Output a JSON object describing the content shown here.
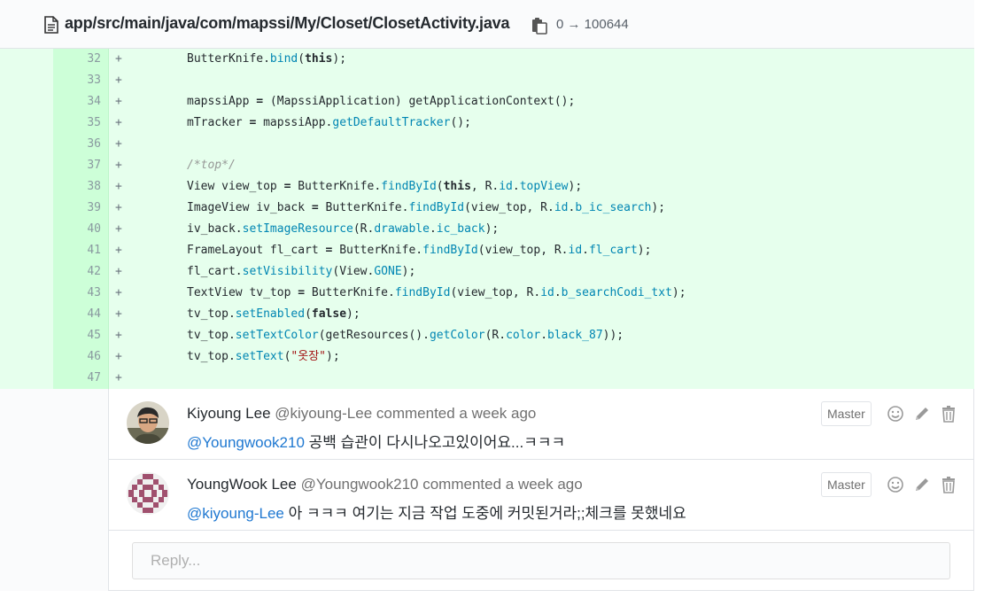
{
  "file": {
    "path": "app/src/main/java/com/mapssi/My/Closet/ClosetActivity.java",
    "mode_change": "0 → 100644"
  },
  "diff_lines": [
    {
      "num": "32",
      "sign": "+"
    },
    {
      "num": "33",
      "sign": "+"
    },
    {
      "num": "34",
      "sign": "+"
    },
    {
      "num": "35",
      "sign": "+"
    },
    {
      "num": "36",
      "sign": "+"
    },
    {
      "num": "37",
      "sign": "+"
    },
    {
      "num": "38",
      "sign": "+"
    },
    {
      "num": "39",
      "sign": "+"
    },
    {
      "num": "40",
      "sign": "+"
    },
    {
      "num": "41",
      "sign": "+"
    },
    {
      "num": "42",
      "sign": "+"
    },
    {
      "num": "43",
      "sign": "+"
    },
    {
      "num": "44",
      "sign": "+"
    },
    {
      "num": "45",
      "sign": "+"
    },
    {
      "num": "46",
      "sign": "+"
    },
    {
      "num": "47",
      "sign": "+"
    }
  ],
  "code": {
    "l32": [
      "ButterKnife.",
      "bind",
      "(",
      "this",
      ");"
    ],
    "l34": [
      "mapssiApp ",
      "=",
      " (MapssiApplication) getApplicationContext();"
    ],
    "l35": [
      "mTracker ",
      "=",
      " mapssiApp.",
      "getDefaultTracker",
      "();"
    ],
    "l37": "/*top*/",
    "l38": [
      "View view_top ",
      "=",
      " ButterKnife.",
      "findById",
      "(",
      "this",
      ", R.",
      "id",
      ".",
      "topView",
      ");"
    ],
    "l39": [
      "ImageView iv_back ",
      "=",
      " ButterKnife.",
      "findById",
      "(view_top, R.",
      "id",
      ".",
      "b_ic_search",
      ");"
    ],
    "l40": [
      "iv_back.",
      "setImageResource",
      "(R.",
      "drawable",
      ".",
      "ic_back",
      ");"
    ],
    "l41": [
      "FrameLayout fl_cart ",
      "=",
      " ButterKnife.",
      "findById",
      "(view_top, R.",
      "id",
      ".",
      "fl_cart",
      ");"
    ],
    "l42": [
      "fl_cart.",
      "setVisibility",
      "(View.",
      "GONE",
      ");"
    ],
    "l43": [
      "TextView tv_top ",
      "=",
      " ButterKnife.",
      "findById",
      "(view_top, R.",
      "id",
      ".",
      "b_searchCodi_txt",
      ");"
    ],
    "l44": [
      "tv_top.",
      "setEnabled",
      "(",
      "false",
      ");"
    ],
    "l45": [
      "tv_top.",
      "setTextColor",
      "(getResources().",
      "getColor",
      "(R.",
      "color",
      ".",
      "black_87",
      "));"
    ],
    "l46": [
      "tv_top.",
      "setText",
      "(",
      "\"옷장\"",
      ");"
    ]
  },
  "comments": [
    {
      "author_name": "Kiyoung Lee",
      "author_handle": "@kiyoung-Lee",
      "meta": "commented a week ago",
      "mention": "@Youngwook210",
      "text": " 공백 습관이 다시나오고있이어요...ㅋㅋㅋ",
      "role": "Master"
    },
    {
      "author_name": "YoungWook Lee",
      "author_handle": "@Youngwook210",
      "meta": "commented a week ago",
      "mention": "@kiyoung-Lee",
      "text": " 아 ㅋㅋㅋ 여기는 지금 작업 도중에 커밋된거라;;체크를 못했네요",
      "role": "Master"
    }
  ],
  "reply": {
    "placeholder": "Reply..."
  },
  "icons": {
    "file": "file-text-icon",
    "copy": "copy-icon",
    "emoji": "smiley-icon",
    "edit": "pencil-icon",
    "delete": "trash-icon"
  },
  "colors": {
    "added_bg": "#e6ffed",
    "added_gutter": "#cdffd8",
    "link": "#1f78d1"
  }
}
